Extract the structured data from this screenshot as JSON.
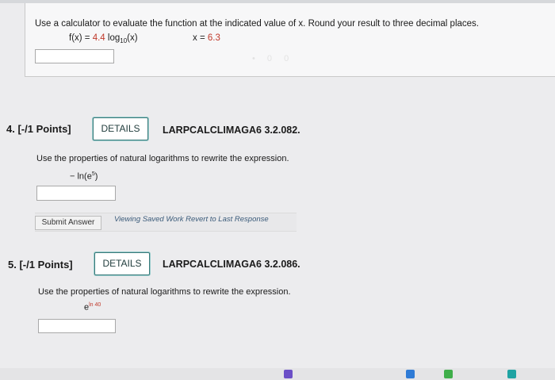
{
  "q3": {
    "instruction": "Use a calculator to evaluate the function at the indicated value of x. Round your result to three decimal places.",
    "f_lhs": "f(x) = ",
    "coef": "4.4",
    "log": " log",
    "log_base": "10",
    "log_arg": "(x)",
    "x_lhs": "x = ",
    "x_value": "6.3",
    "faint_text": "• 0 0"
  },
  "q4": {
    "number": "4.",
    "points": "[-/1 Points]",
    "details_label": "DETAILS",
    "code": "LARPCALCLIMAGA6 3.2.082.",
    "instruction": "Use the properties of natural logarithms to rewrite the expression.",
    "expr_prefix": "− ",
    "expr_base": "ln(e",
    "expr_exp": "5",
    "expr_close": ")",
    "submit_label": "Submit Answer",
    "saved_note": "Viewing Saved Work Revert to Last Response"
  },
  "q5": {
    "number": "5.",
    "points": "[-/1 Points]",
    "details_label": "DETAILS",
    "code": "LARPCALCLIMAGA6 3.2.086.",
    "instruction": "Use the properties of natural logarithms to rewrite the expression.",
    "expr_base": "e",
    "expr_exp": "ln 40"
  },
  "taskbar_icons": [
    "purple-app-icon",
    "blue-app-icon",
    "green-app-icon",
    "teal-app-icon"
  ]
}
